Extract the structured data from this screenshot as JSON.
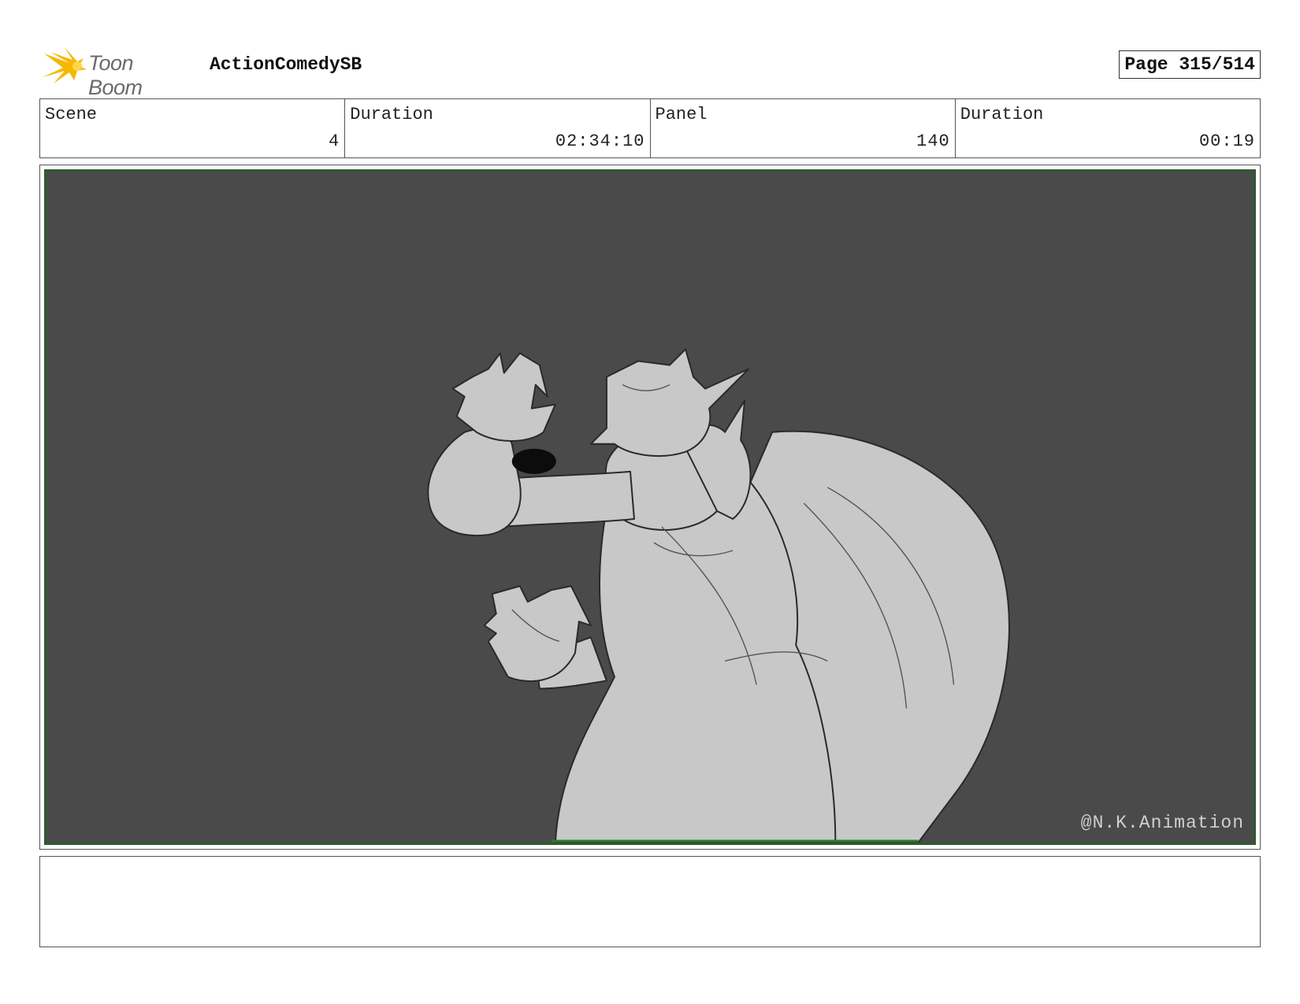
{
  "header": {
    "logo_text": "Toon Boom",
    "project_title": "ActionComedySB",
    "page_label": "Page 315/514"
  },
  "info": [
    {
      "label": "Scene",
      "value": "4"
    },
    {
      "label": "Duration",
      "value": "02:34:10"
    },
    {
      "label": "Panel",
      "value": "140"
    },
    {
      "label": "Duration",
      "value": "00:19"
    }
  ],
  "panel": {
    "image": "sketch of a caped, pointy-eared brute character winding up clawed fists",
    "watermark": "@N.K.Animation"
  },
  "notes": {
    "text": ""
  },
  "colors": {
    "panel_background": "#4a4a4a",
    "panel_border": "#2e5b2e",
    "sketch_fill": "#c8c8c8",
    "logo_accent": "#f5b800"
  }
}
